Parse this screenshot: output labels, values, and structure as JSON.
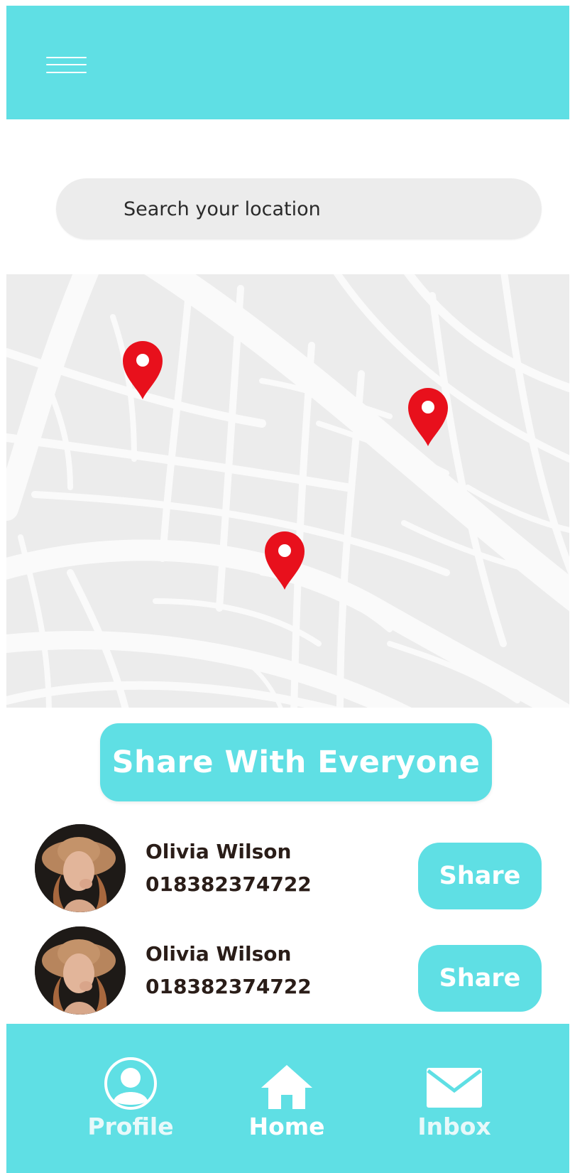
{
  "header": {
    "menu_icon": "hamburger-icon"
  },
  "search": {
    "placeholder": "Search your location"
  },
  "map": {
    "pin_icon": "map-pin-icon",
    "pin_color": "#e8101c",
    "pin_count": 3
  },
  "share_all": {
    "label": "Share With Everyone"
  },
  "contacts": [
    {
      "name": "Olivia Wilson",
      "phone": "018382374722",
      "share_label": "Share"
    },
    {
      "name": "Olivia Wilson",
      "phone": "018382374722",
      "share_label": "Share"
    }
  ],
  "nav": {
    "items": [
      {
        "label": "Profile",
        "icon": "user-icon",
        "active": false
      },
      {
        "label": "Home",
        "icon": "home-icon",
        "active": true
      },
      {
        "label": "Inbox",
        "icon": "mail-icon",
        "active": false
      }
    ]
  },
  "colors": {
    "accent": "#5fdfe4",
    "map_block": "#ececec",
    "map_road": "#fafafa",
    "text_dark": "#2a1d18",
    "white": "#ffffff"
  }
}
